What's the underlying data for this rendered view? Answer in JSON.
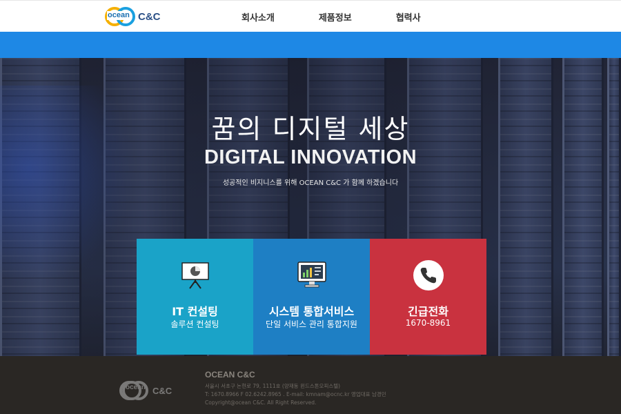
{
  "header": {
    "logo_word": "ocean",
    "logo_cc": "C&C",
    "nav": [
      "회사소개",
      "제품정보",
      "협력사"
    ]
  },
  "hero": {
    "title": "꿈의 디지털 세상",
    "subtitle": "DIGITAL INNOVATION",
    "description": "성공적인 비지니스를 위해 OCEAN C&C 가 함께 하겠습니다"
  },
  "cards": [
    {
      "title": "IT 컨설팅",
      "text": "솔루션 컨설팅",
      "icon": "presentation-board-icon",
      "color": "#1aa3c8"
    },
    {
      "title": "시스템 통합서비스",
      "text": "단일 서비스 관리 통합지원",
      "icon": "monitor-chart-icon",
      "color": "#1e7fc4"
    },
    {
      "title": "긴급전화",
      "text": "1670-8961",
      "icon": "phone-icon",
      "color": "#c9323f"
    }
  ],
  "footer": {
    "logo_word": "ocean",
    "logo_cc": "C&C",
    "company": "OCEAN C&C",
    "address": "서울시 서초구 논현로 79, 1111호 (양재동 윈드스톤오피스텔)",
    "contact": "T: 1670.8966 F 02.6242.8965 . E-mail: kmnam@ocnc.kr 영업대표 남경민",
    "copyright": "Copyright@ocean C&C. All Right Reserved."
  },
  "colors": {
    "accent_blue_bar": "#1e88e5",
    "footer_bg": "#2a2724"
  }
}
